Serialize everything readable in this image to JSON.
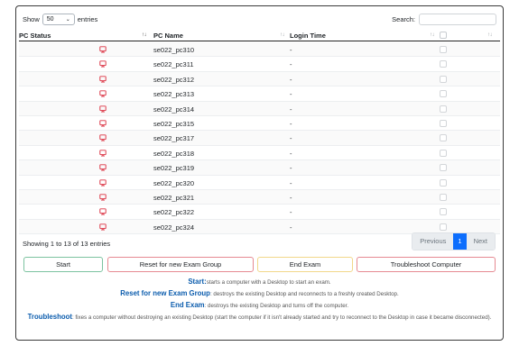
{
  "length": {
    "show_label": "Show",
    "value": "50",
    "entries_label": "entries"
  },
  "search": {
    "label": "Search:",
    "value": ""
  },
  "table": {
    "columns": [
      {
        "label": "PC Status"
      },
      {
        "label": "PC Name"
      },
      {
        "label": "Login Time"
      }
    ],
    "rows": [
      {
        "pc_name": "se022_pc310",
        "login_time": "-"
      },
      {
        "pc_name": "se022_pc311",
        "login_time": "-"
      },
      {
        "pc_name": "se022_pc312",
        "login_time": "-"
      },
      {
        "pc_name": "se022_pc313",
        "login_time": "-"
      },
      {
        "pc_name": "se022_pc314",
        "login_time": "-"
      },
      {
        "pc_name": "se022_pc315",
        "login_time": "-"
      },
      {
        "pc_name": "se022_pc317",
        "login_time": "-"
      },
      {
        "pc_name": "se022_pc318",
        "login_time": "-"
      },
      {
        "pc_name": "se022_pc319",
        "login_time": "-"
      },
      {
        "pc_name": "se022_pc320",
        "login_time": "-"
      },
      {
        "pc_name": "se022_pc321",
        "login_time": "-"
      },
      {
        "pc_name": "se022_pc322",
        "login_time": "-"
      },
      {
        "pc_name": "se022_pc324",
        "login_time": "-"
      }
    ],
    "status_icon": "monitor-icon",
    "status_color": "#dc3545"
  },
  "info": "Showing 1 to 13 of 13 entries",
  "pagination": {
    "previous": "Previous",
    "current": "1",
    "next": "Next"
  },
  "actions": {
    "start": "Start",
    "reset": "Reset for new Exam Group",
    "end": "End Exam",
    "troubleshoot": "Troubleshoot Computer"
  },
  "help": {
    "start_term": "Start:",
    "start_desc": "starts a computer with a Desktop to start an exam.",
    "reset_term": "Reset for new Exam Group",
    "reset_desc": ": destroys the existing Desktop and reconnects to a freshly created Desktop.",
    "end_term": "End Exam",
    "end_desc": ": destroys the existing Desktop and turns off the computer.",
    "trouble_term": "Troubleshoot",
    "trouble_desc": ": fixes a computer without destroying an existing Desktop (start the computer if it isn't already started and try to reconnect to the Desktop in case it became disconnected)."
  }
}
